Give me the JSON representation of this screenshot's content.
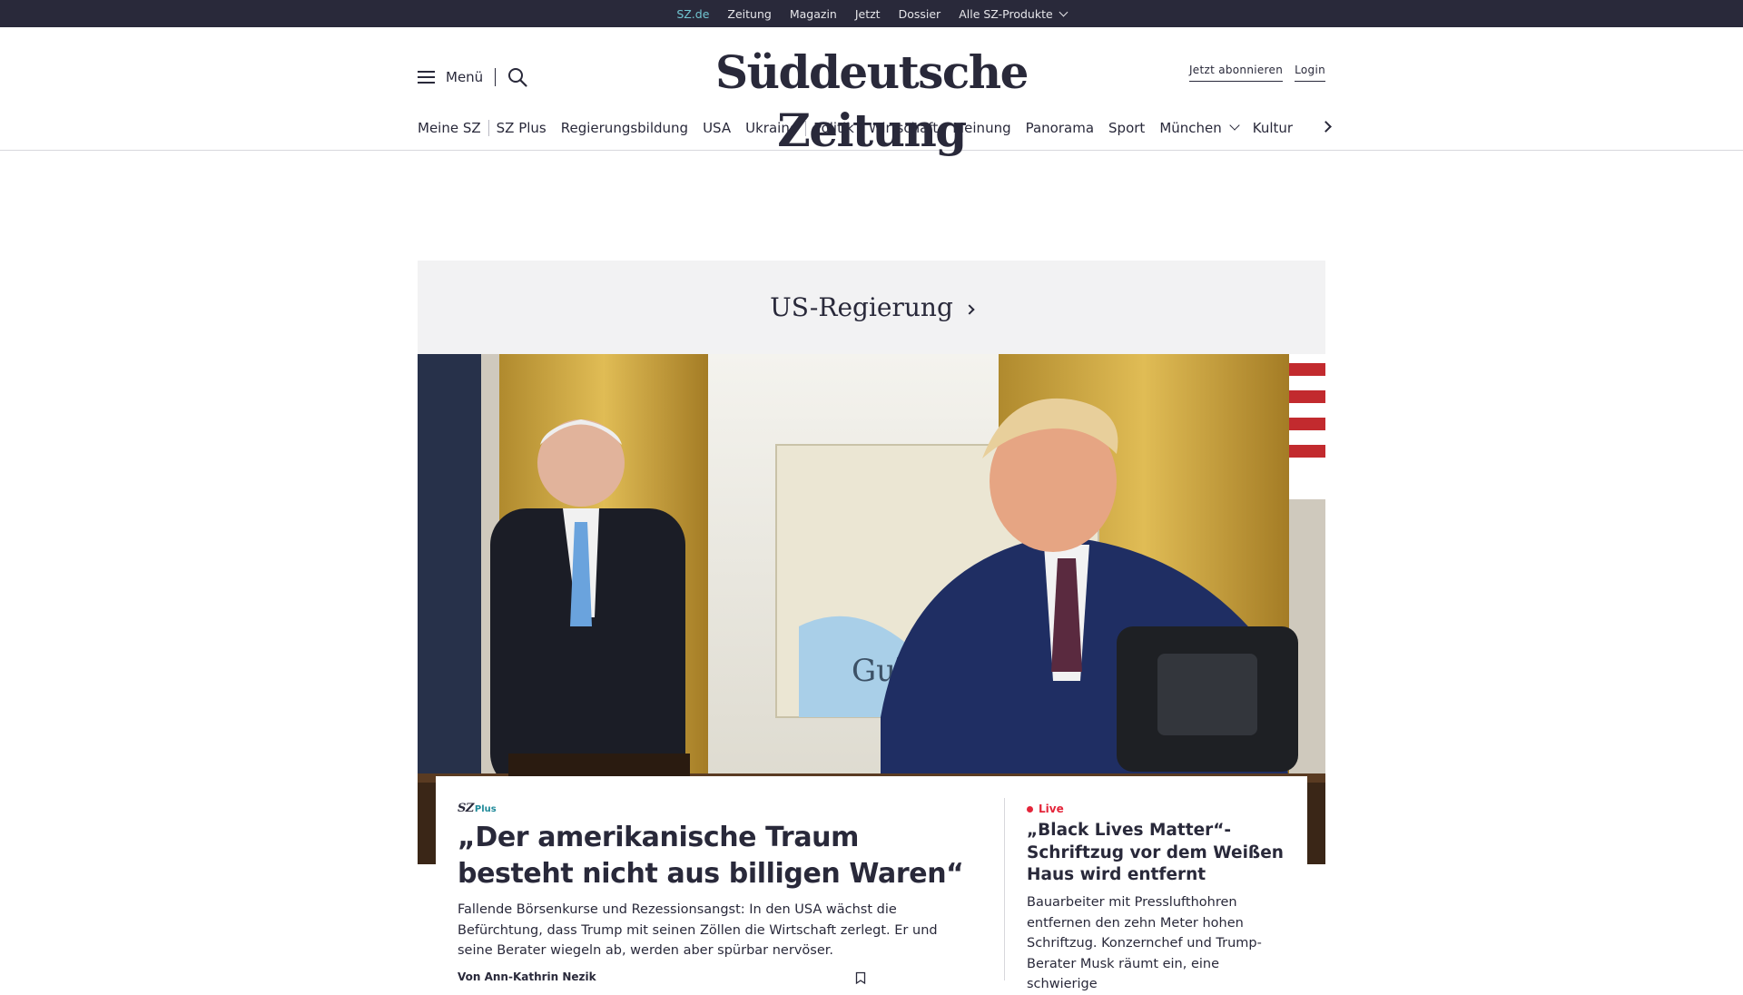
{
  "topbar": {
    "links": [
      {
        "label": "SZ.de",
        "active": true
      },
      {
        "label": "Zeitung",
        "active": false
      },
      {
        "label": "Magazin",
        "active": false
      },
      {
        "label": "Jetzt",
        "active": false
      },
      {
        "label": "Dossier",
        "active": false
      },
      {
        "label": "Alle SZ-Produkte",
        "active": false,
        "dropdown": true
      }
    ]
  },
  "header": {
    "menu_label": "Menü",
    "logo_text": "Süddeutsche Zeitung",
    "subscribe_label": "Jetzt abonnieren",
    "login_label": "Login"
  },
  "ressorts": {
    "items": [
      "Meine SZ",
      "SZ Plus",
      "Regierungsbildung",
      "USA",
      "Ukraine",
      "Politik",
      "Wirtschaft",
      "Meinung",
      "Panorama",
      "Sport",
      "München",
      "Kultur"
    ]
  },
  "topic": {
    "title": "US-Regierung"
  },
  "hero": {
    "map_label": "Gulf"
  },
  "main_article": {
    "badge_sz": "SZ",
    "badge_plus": "Plus",
    "headline": "„Der amerikanische Traum besteht nicht aus billigen Waren“",
    "teaser": "Fallende Börsenkurse und Rezessionsangst: In den USA wächst die Befürchtung, dass Trump mit seinen Zöllen die Wirtschaft zerlegt. Er und seine Berater wiegeln ab, werden aber spürbar nervöser.",
    "author": "Von Ann-Kathrin Nezik"
  },
  "side_article": {
    "live_label": "Live",
    "headline": "„Black Lives Matter“-Schriftzug vor dem Weißen Haus wird entfernt",
    "teaser": "Bauarbeiter mit Presslufthohren entfernen den zehn Meter hohen Schriftzug. Konzernchef und Trump-Berater Musk räumt ein, eine schwierige"
  },
  "colors": {
    "topbar_bg": "#29293a",
    "active_link": "#71c5d1",
    "plus_accent": "#1f8a99",
    "live_red": "#e4253a",
    "topic_bg": "#f2f2f3"
  }
}
